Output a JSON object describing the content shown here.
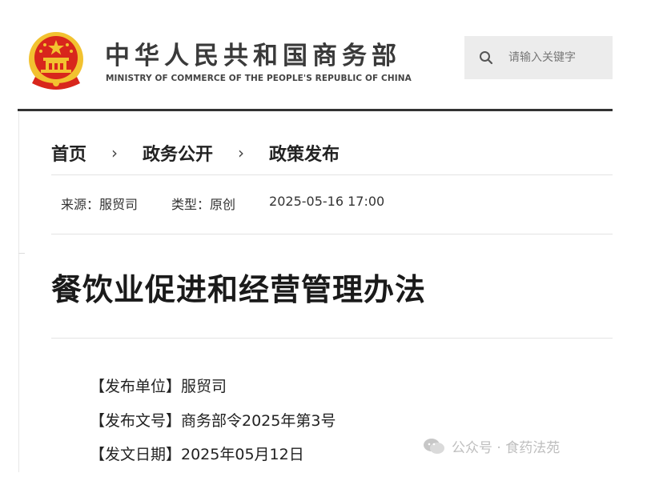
{
  "header": {
    "title_cn": "中华人民共和国商务部",
    "title_en": "MINISTRY OF COMMERCE OF THE PEOPLE'S REPUBLIC OF CHINA",
    "search_placeholder": "请输入关键字",
    "emblem_colors": {
      "red": "#d8261c",
      "gold": "#f2c230"
    }
  },
  "breadcrumb": {
    "items": [
      "首页",
      "政务公开",
      "政策发布"
    ],
    "separator": "›"
  },
  "meta": {
    "source": "来源：服贸司",
    "type": "类型：原创",
    "datetime": "2025-05-16 17:00"
  },
  "article": {
    "title": "餐饮业促进和经营管理办法",
    "info": [
      "【发布单位】服贸司",
      "【发布文号】商务部令2025年第3号",
      "【发文日期】2025年05月12日"
    ]
  },
  "watermark": {
    "text": "公众号 · 食药法苑",
    "icon": "wechat-icon"
  }
}
